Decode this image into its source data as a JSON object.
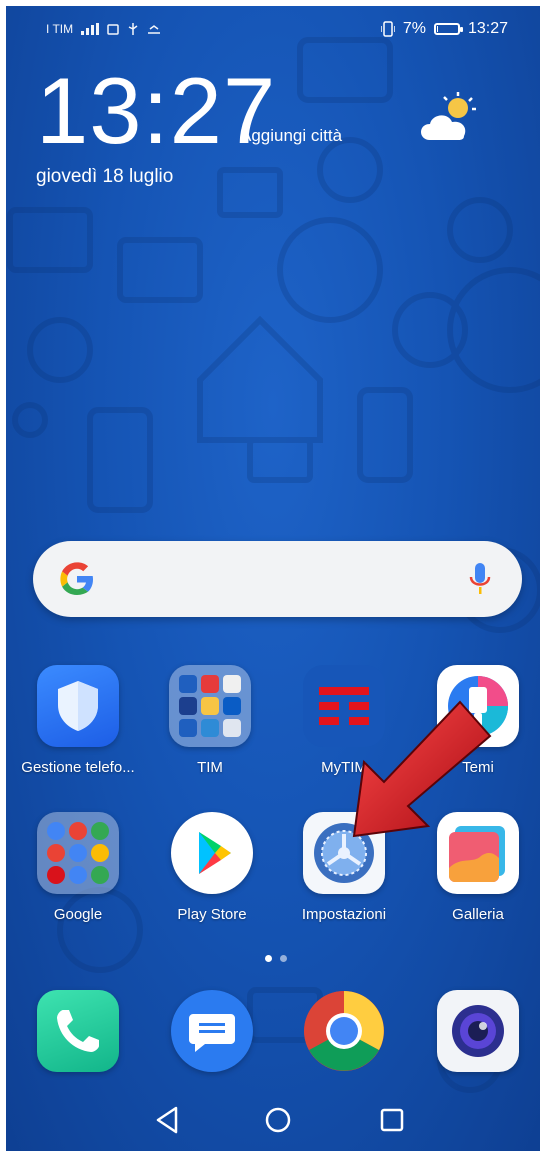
{
  "status_bar": {
    "carrier": "I TIM",
    "battery_text": "7%",
    "battery_level": 0.07,
    "time": "13:27"
  },
  "clock_widget": {
    "time": "13:27",
    "add_city": "Aggiungi città",
    "date": "giovedì 18 luglio",
    "weather_icon": "partly-cloudy-icon"
  },
  "search": {
    "logo": "google-g-icon",
    "mic_icon": "mic-icon"
  },
  "apps_row1": [
    {
      "label": "Gestione telefo...",
      "icon": "shield-icon"
    },
    {
      "label": "TIM",
      "icon": "folder-icon"
    },
    {
      "label": "MyTIM",
      "icon": "mytim-icon"
    },
    {
      "label": "Temi",
      "icon": "paintbrush-icon"
    }
  ],
  "apps_row2": [
    {
      "label": "Google",
      "icon": "google-folder-icon"
    },
    {
      "label": "Play Store",
      "icon": "play-store-icon"
    },
    {
      "label": "Impostazioni",
      "icon": "settings-icon"
    },
    {
      "label": "Galleria",
      "icon": "gallery-icon"
    }
  ],
  "dock": [
    {
      "icon": "phone-icon"
    },
    {
      "icon": "messages-icon"
    },
    {
      "icon": "chrome-icon"
    },
    {
      "icon": "camera-icon"
    }
  ],
  "navigation": {
    "back": "back-icon",
    "home": "home-icon",
    "recents": "recents-icon"
  },
  "colors": {
    "wallpaper": "#1554b4",
    "accent_red": "#d9121b"
  }
}
